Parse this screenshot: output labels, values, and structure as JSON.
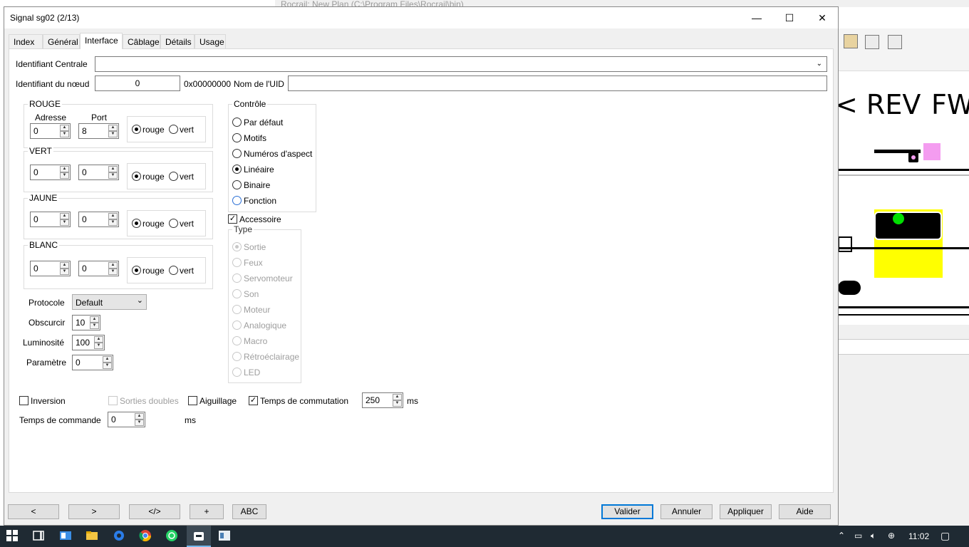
{
  "background_app": {
    "title": "Rocrail: New Plan (C:\\Program Files\\Rocrail\\bin)",
    "plan_labels": [
      "< REV",
      "FW"
    ]
  },
  "dialog": {
    "title": "Signal sg02 (2/13)",
    "window_controls": {
      "minimize": "—",
      "maximize": "☐",
      "close": "✕"
    },
    "tabs": [
      "Index",
      "Général",
      "Interface",
      "Câblage",
      "Détails",
      "Usage"
    ],
    "active_tab": "Interface",
    "fields": {
      "central_label": "Identifiant Centrale",
      "central_value": "",
      "node_label": "Identifiant du nœud",
      "node_value": "0",
      "node_hex": "0x00000000",
      "uid_label": "Nom de l'UID",
      "uid_value": ""
    },
    "color_groups": [
      {
        "title": "ROUGE",
        "address_label": "Adresse",
        "port_label": "Port",
        "address": "0",
        "port": "8",
        "option1": "rouge",
        "option2": "vert",
        "selected": "rouge"
      },
      {
        "title": "VERT",
        "address": "0",
        "port": "0",
        "option1": "rouge",
        "option2": "vert",
        "selected": "rouge"
      },
      {
        "title": "JAUNE",
        "address": "0",
        "port": "0",
        "option1": "rouge",
        "option2": "vert",
        "selected": "rouge"
      },
      {
        "title": "BLANC",
        "address": "0",
        "port": "0",
        "option1": "rouge",
        "option2": "vert",
        "selected": "rouge"
      }
    ],
    "protocol": {
      "label": "Protocole",
      "value": "Default"
    },
    "obscurcir": {
      "label": "Obscurcir",
      "value": "10"
    },
    "luminosite": {
      "label": "Luminosité",
      "value": "100"
    },
    "parametre": {
      "label": "Paramètre",
      "value": "0"
    },
    "control": {
      "title": "Contrôle",
      "options": [
        "Par défaut",
        "Motifs",
        "Numéros d'aspect",
        "Linéaire",
        "Binaire",
        "Fonction"
      ],
      "selected": "Linéaire"
    },
    "accessory": {
      "label": "Accessoire",
      "checked": true
    },
    "type": {
      "title": "Type",
      "options": [
        "Sortie",
        "Feux",
        "Servomoteur",
        "Son",
        "Moteur",
        "Analogique",
        "Macro",
        "Rétroéclairage",
        "LED"
      ],
      "selected": "Sortie",
      "disabled": true
    },
    "options_row": {
      "inversion": "Inversion",
      "sorties_doubles": "Sorties doubles",
      "aiguillage": "Aiguillage",
      "temps_commutation": "Temps de commutation",
      "temps_commutation_value": "250",
      "unit": "ms"
    },
    "command_time": {
      "label": "Temps de commande",
      "value": "0",
      "unit": "ms"
    },
    "bottom_buttons": [
      "<",
      ">",
      "</>",
      "+",
      "ABC"
    ],
    "action_buttons": [
      "Valider",
      "Annuler",
      "Appliquer",
      "Aide"
    ]
  },
  "taskbar": {
    "time": "11:02",
    "icons": [
      "windows-start-icon",
      "task-view-icon",
      "outlook-icon",
      "file-explorer-icon",
      "edge-icon",
      "chrome-icon",
      "whatsapp-icon",
      "rocrail-icon",
      "app-icon"
    ]
  },
  "colors": {
    "accent": "#0078d7",
    "signal_green": "#00e000",
    "track_yellow": "#ffff00",
    "marker_pink": "#f49cf0"
  }
}
